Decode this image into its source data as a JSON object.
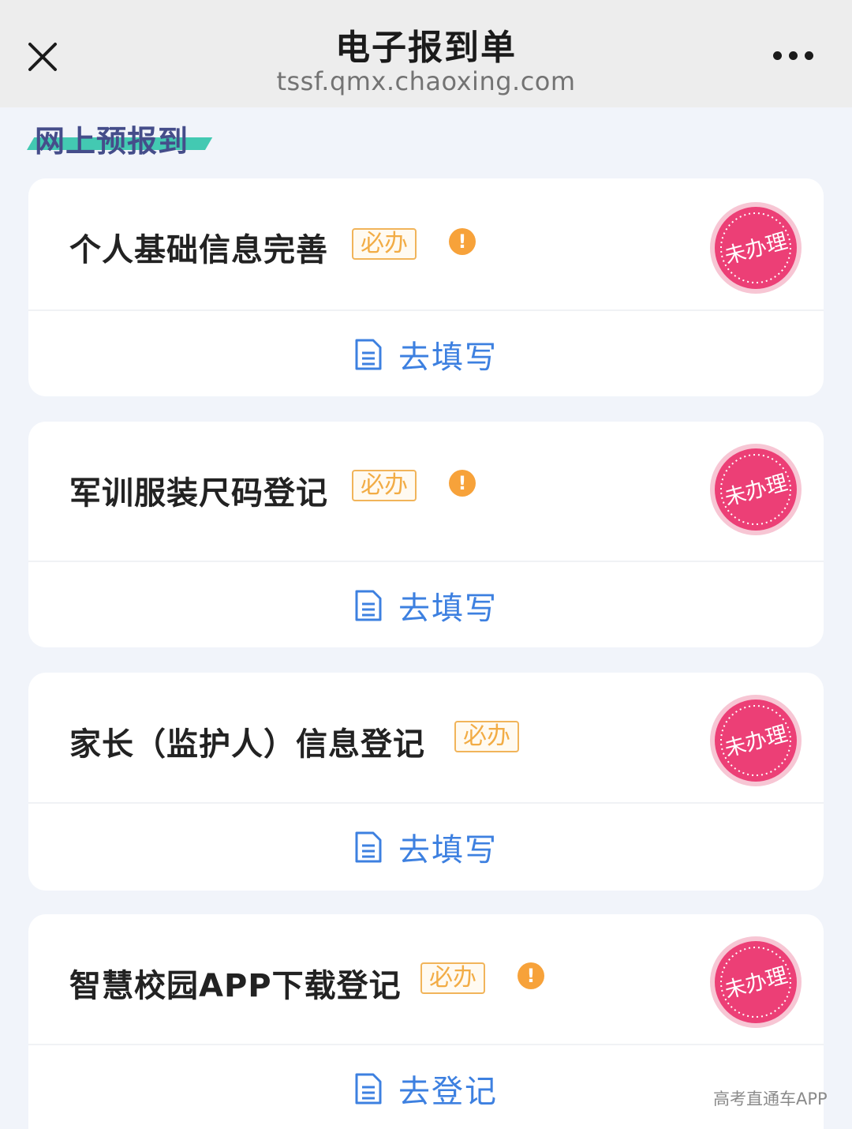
{
  "header": {
    "title": "电子报到单",
    "url": "tssf.qmx.chaoxing.com",
    "close_icon": "close-icon",
    "more_icon": "more-icon"
  },
  "section": {
    "title": "网上预报到"
  },
  "colors": {
    "accent_blue": "#3d80e0",
    "required_orange": "#f2ac45",
    "stamp_pink": "#ec3f76",
    "section_teal": "#43c9b2"
  },
  "cards": [
    {
      "title": "个人基础信息完善",
      "badge": "必办",
      "warning": true,
      "stamp_text": "未办理",
      "action_label": "去填写",
      "action_icon": "document-icon"
    },
    {
      "title": "军训服装尺码登记",
      "badge": "必办",
      "warning": true,
      "stamp_text": "未办理",
      "action_label": "去填写",
      "action_icon": "document-icon"
    },
    {
      "title": "家长（监护人）信息登记",
      "badge": "必办",
      "warning": false,
      "stamp_text": "未办理",
      "action_label": "去填写",
      "action_icon": "document-icon"
    },
    {
      "title": "智慧校园APP下载登记",
      "badge": "必办",
      "warning": true,
      "stamp_text": "未办理",
      "action_label": "去登记",
      "action_icon": "document-icon"
    }
  ],
  "watermark": "高考直通车APP"
}
